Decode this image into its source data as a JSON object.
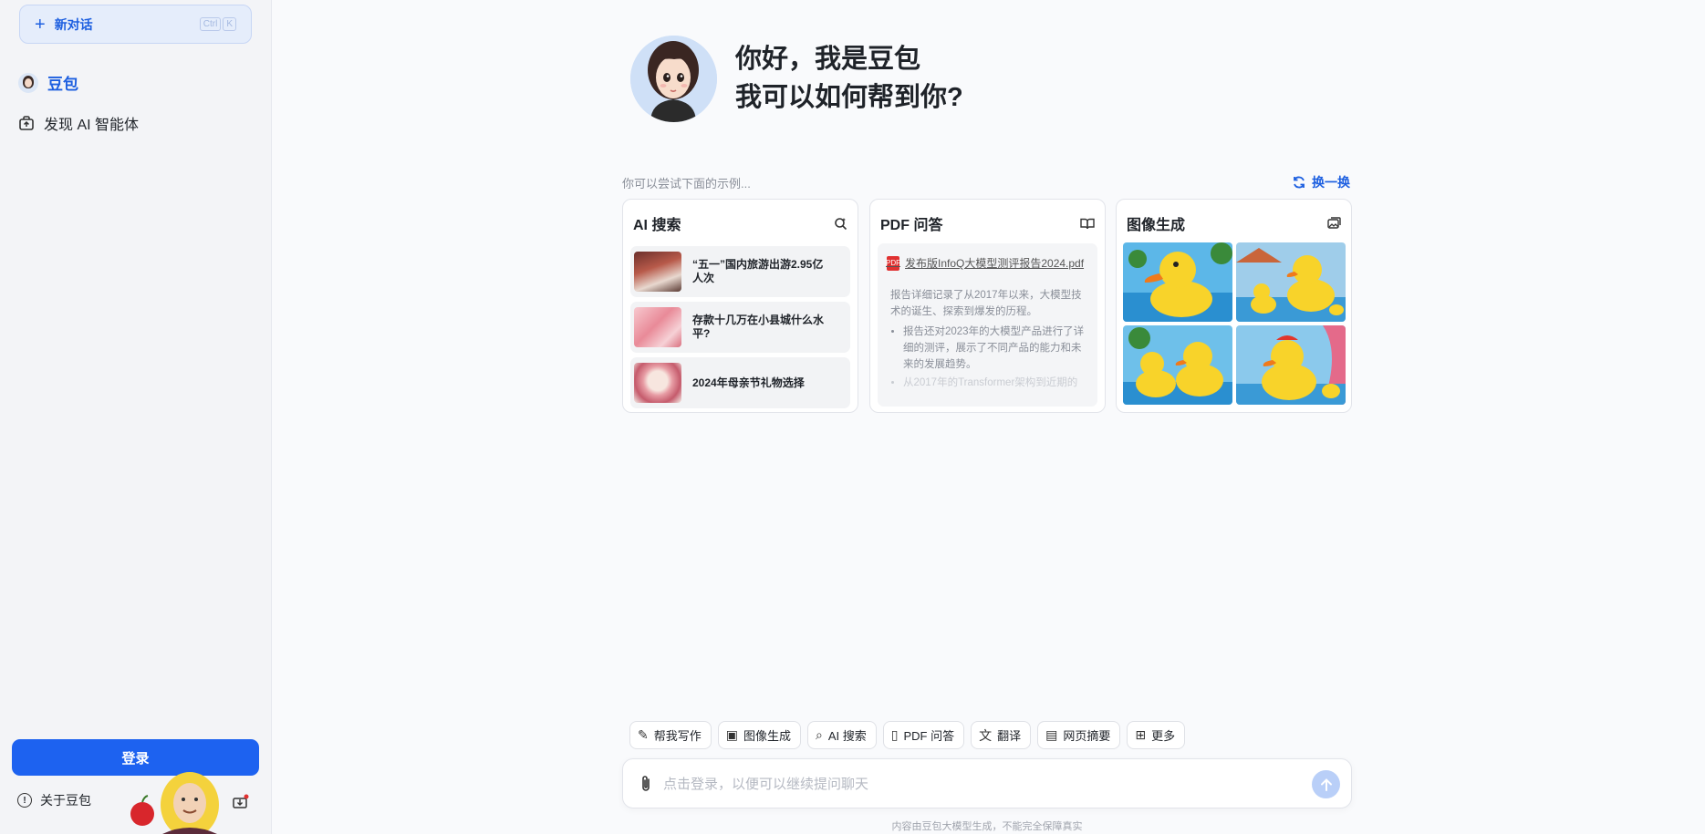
{
  "sidebar": {
    "new_chat_label": "新对话",
    "shortcut_keys": [
      "Ctrl",
      "K"
    ],
    "nav_active_label": "豆包",
    "nav_discover_label": "发现 AI 智能体",
    "login_label": "登录",
    "about_label": "关于豆包"
  },
  "hero": {
    "line1": "你好，我是豆包",
    "line2": "我可以如何帮到你?"
  },
  "examples": {
    "hint": "你可以尝试下面的示例...",
    "refresh_label": "换一换",
    "cards": {
      "search": {
        "title": "AI 搜索",
        "items": [
          "“五一”国内旅游出游2.95亿人次",
          "存款十几万在小县城什么水平?",
          "2024年母亲节礼物选择"
        ]
      },
      "pdf": {
        "title": "PDF 问答",
        "file_name": "发布版InfoQ大模型测评报告2024.pdf",
        "summary": "报告详细记录了从2017年以来，大模型技术的诞生、探索到爆发的历程。",
        "bullets": [
          "报告还对2023年的大模型产品进行了详细的测评，展示了不同产品的能力和未来的发展趋势。",
          "从2017年的Transformer架构到近期的"
        ]
      },
      "image": {
        "title": "图像生成"
      }
    }
  },
  "toolbar": {
    "tools": [
      "帮我写作",
      "图像生成",
      "AI 搜索",
      "PDF 问答",
      "翻译",
      "网页摘要",
      "更多"
    ]
  },
  "composer": {
    "placeholder": "点击登录，以便可以继续提问聊天"
  },
  "footer_note": "内容由豆包大模型生成，不能完全保障真实",
  "colors": {
    "accent": "#1d62f0",
    "sidebar_bg": "#f3f4f7",
    "page_bg": "#f9fafc"
  }
}
